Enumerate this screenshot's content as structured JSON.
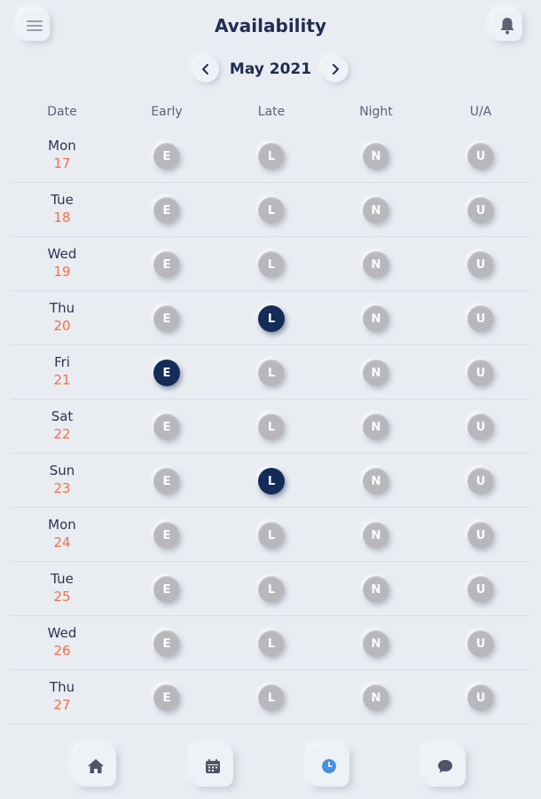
{
  "header": {
    "title": "Availability",
    "menu_icon": "hamburger-menu-icon",
    "bell_icon": "bell-icon"
  },
  "month_nav": {
    "label": "May 2021",
    "prev_icon": "chevron-left-icon",
    "next_icon": "chevron-right-icon"
  },
  "columns": [
    "Date",
    "Early",
    "Late",
    "Night",
    "U/A"
  ],
  "shift_letters": [
    "E",
    "L",
    "N",
    "U"
  ],
  "rows": [
    {
      "day": "Mon",
      "date": "17",
      "selected": null
    },
    {
      "day": "Tue",
      "date": "18",
      "selected": null
    },
    {
      "day": "Wed",
      "date": "19",
      "selected": null
    },
    {
      "day": "Thu",
      "date": "20",
      "selected": "L"
    },
    {
      "day": "Fri",
      "date": "21",
      "selected": "E"
    },
    {
      "day": "Sat",
      "date": "22",
      "selected": null
    },
    {
      "day": "Sun",
      "date": "23",
      "selected": "L"
    },
    {
      "day": "Mon",
      "date": "24",
      "selected": null
    },
    {
      "day": "Tue",
      "date": "25",
      "selected": null
    },
    {
      "day": "Wed",
      "date": "26",
      "selected": null
    },
    {
      "day": "Thu",
      "date": "27",
      "selected": null
    }
  ],
  "bottom_nav": [
    {
      "icon": "home-icon",
      "active": false
    },
    {
      "icon": "calendar-icon",
      "active": false
    },
    {
      "icon": "clock-icon",
      "active": true
    },
    {
      "icon": "chat-icon",
      "active": false
    }
  ],
  "colors": {
    "background": "#e9ecf1",
    "title": "#1f2d52",
    "date_number": "#f07149",
    "shift_inactive": "#b8b8bc",
    "shift_active": "#142c58",
    "active_nav": "#4a90e2"
  }
}
